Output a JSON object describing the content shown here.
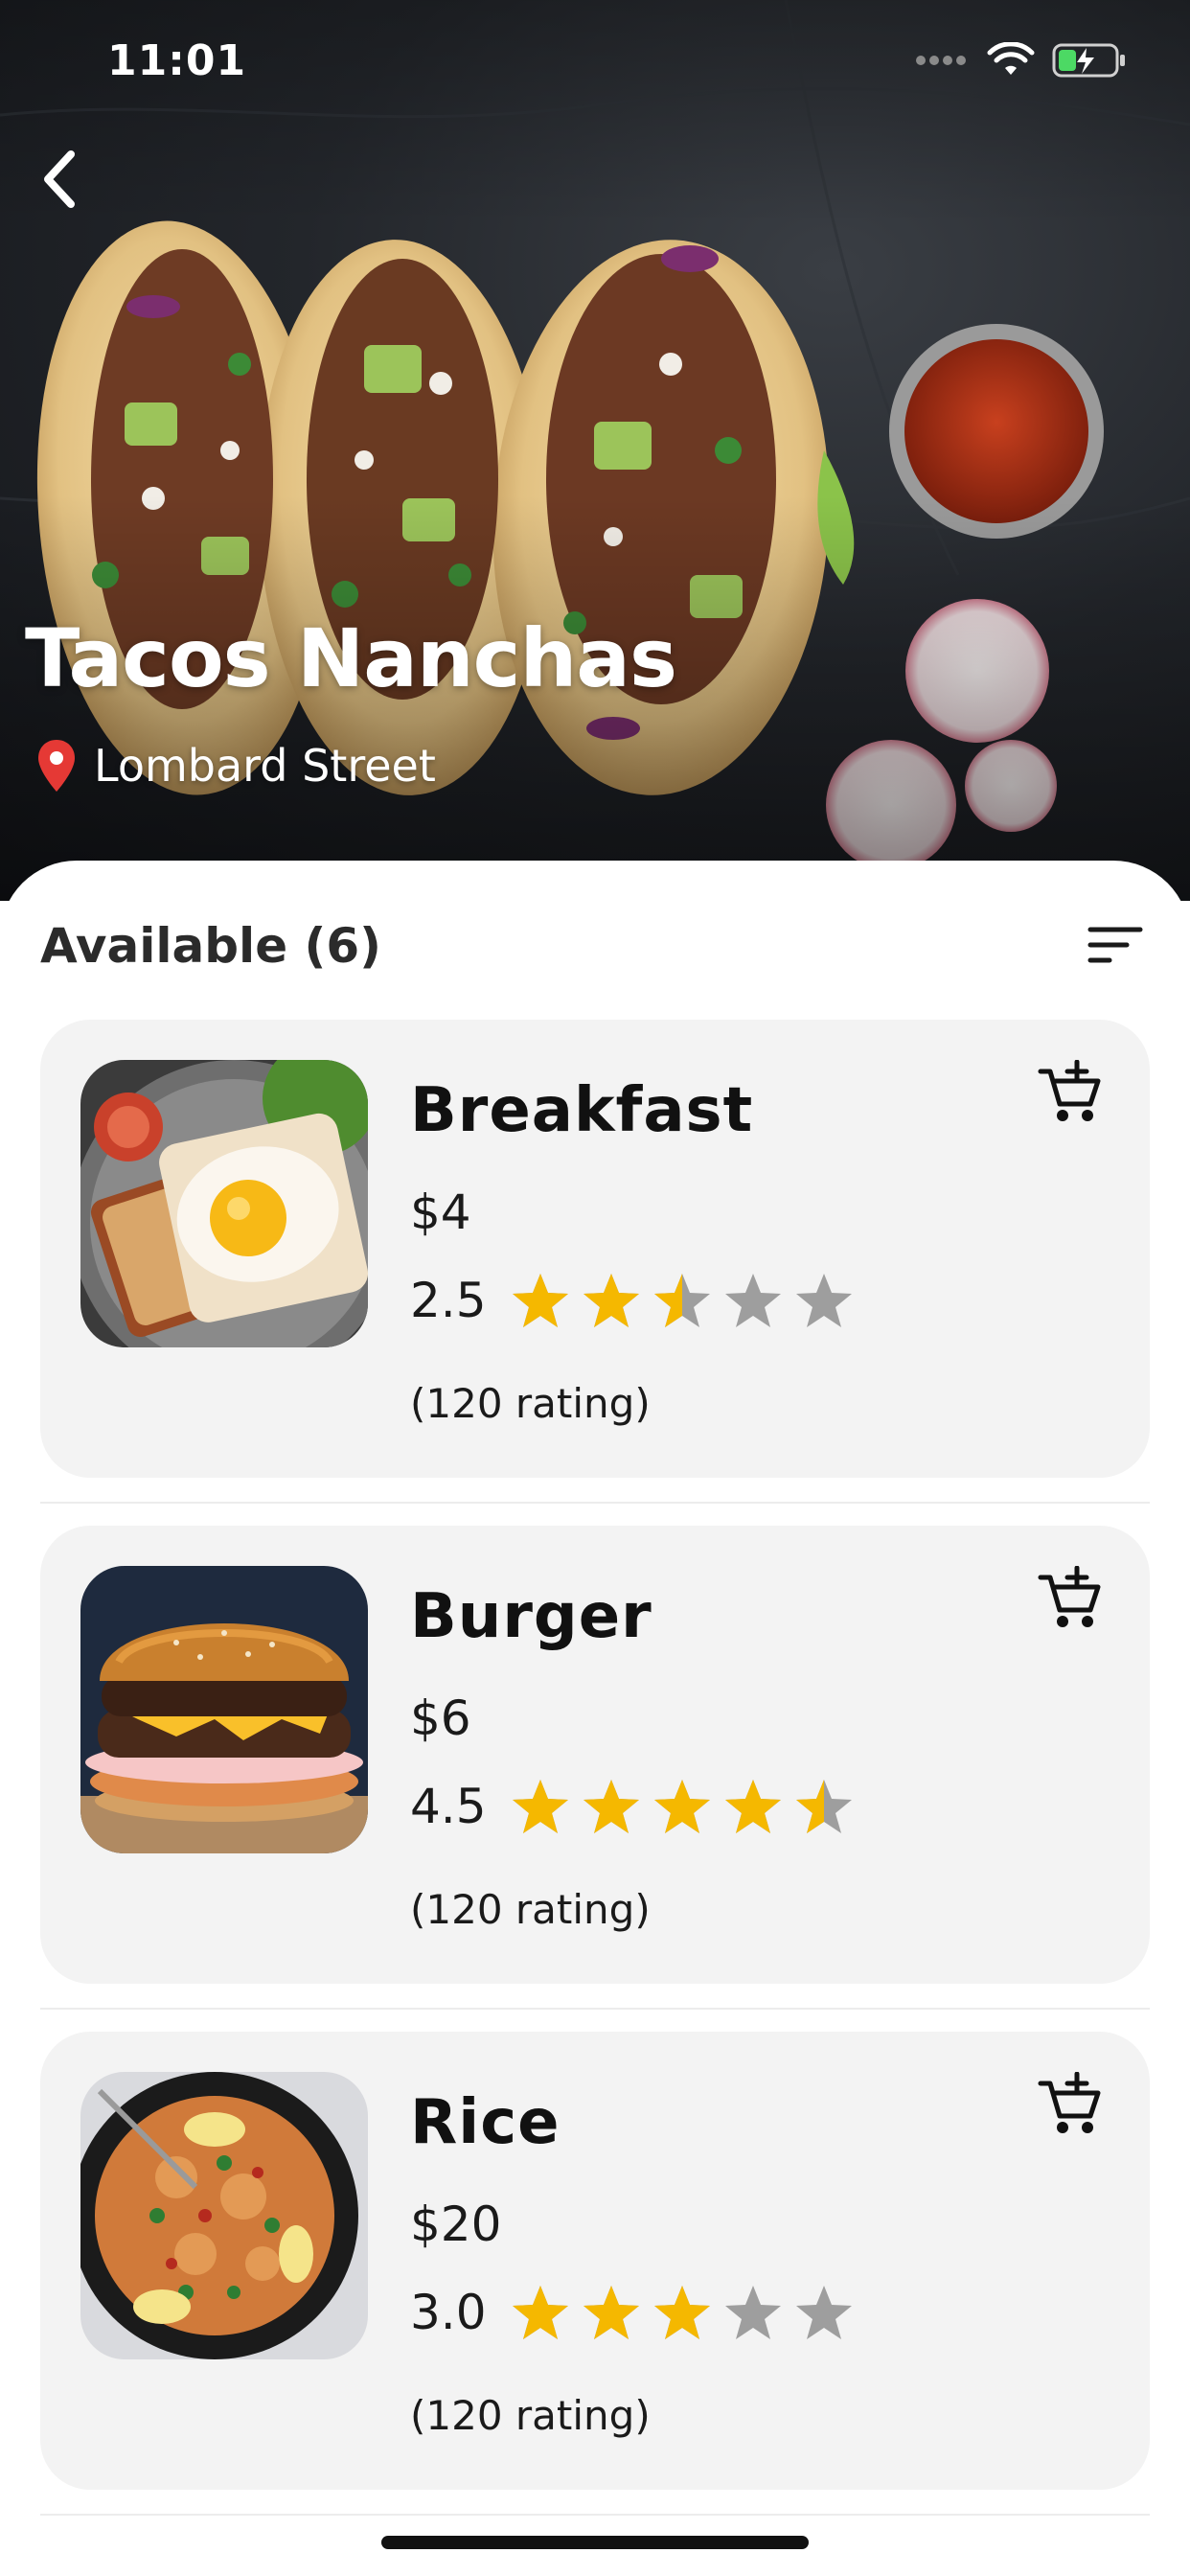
{
  "status_bar": {
    "time": "11:01",
    "icons": [
      "signal-dots-icon",
      "wifi-icon",
      "battery-charging-icon"
    ]
  },
  "hero": {
    "title": "Tacos Nanchas",
    "location": "Lombard Street",
    "back_icon": "chevron-left-icon",
    "location_icon": "map-pin-icon",
    "pin_color": "#e53935"
  },
  "list": {
    "header": "Available (6)",
    "sort_icon": "sort-lines-icon"
  },
  "items": [
    {
      "name": "Breakfast",
      "price": "$4",
      "rating": "2.5",
      "rating_value": 2.5,
      "rating_count": "(120 rating)",
      "cart_icon": "add-to-cart-icon"
    },
    {
      "name": "Burger",
      "price": "$6",
      "rating": "4.5",
      "rating_value": 4.5,
      "rating_count": "(120 rating)",
      "cart_icon": "add-to-cart-icon"
    },
    {
      "name": "Rice",
      "price": "$20",
      "rating": "3.0",
      "rating_value": 3.0,
      "rating_count": "(120 rating)",
      "cart_icon": "add-to-cart-icon"
    }
  ],
  "colors": {
    "star_filled": "#f5b800",
    "star_empty": "#9e9e9e",
    "card_bg": "#f3f3f3"
  }
}
